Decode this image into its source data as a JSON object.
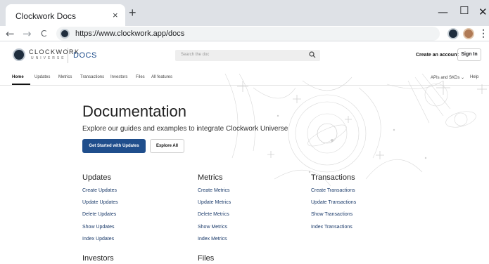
{
  "browser": {
    "tab_title": "Clockwork Docs",
    "tab_close": "×",
    "new_tab": "+",
    "minimize": "—",
    "maximize": "☐",
    "close": "✕",
    "back": "←",
    "forward": "→",
    "reload": "C",
    "url": "https://www.clockwork.app/docs",
    "menu": "⋮"
  },
  "header": {
    "logo_text": "CLOCKWORK",
    "logo_sub": "UNIVERSE",
    "docs_label": "DOCS",
    "search_placeholder": "Search the doc",
    "create_account": "Create an account",
    "sign_in": "Sign In"
  },
  "subnav": {
    "items": [
      "Home",
      "Updates",
      "Metrics",
      "Transactions",
      "Investors",
      "Files",
      "All features"
    ],
    "right_items": [
      "APIs and SKDs ⌄",
      "Help"
    ]
  },
  "hero": {
    "title": "Documentation",
    "description": "Explore our guides and examples to integrate Clockwork Universe",
    "primary_button": "Get Started with Updates",
    "secondary_button": "Explore All"
  },
  "sections": [
    {
      "title": "Updates",
      "links": [
        "Create Updates",
        "Update Updates",
        "Delete Updates",
        "Show Updates",
        "Index Updates"
      ]
    },
    {
      "title": "Metrics",
      "links": [
        "Create Metrics",
        "Update Metrics",
        "Delete Metrics",
        "Show Metrics",
        "Index Metrics"
      ]
    },
    {
      "title": "Transactions",
      "links": [
        "Create Transactions",
        "Update Transactions",
        "Show Transactions",
        "Index Transactions"
      ]
    },
    {
      "title": "Investors",
      "links": []
    },
    {
      "title": "Files",
      "links": []
    }
  ],
  "colors": {
    "primary": "#1f4e8c",
    "link": "#1a3a6a",
    "chrome": "#dee1e6"
  }
}
